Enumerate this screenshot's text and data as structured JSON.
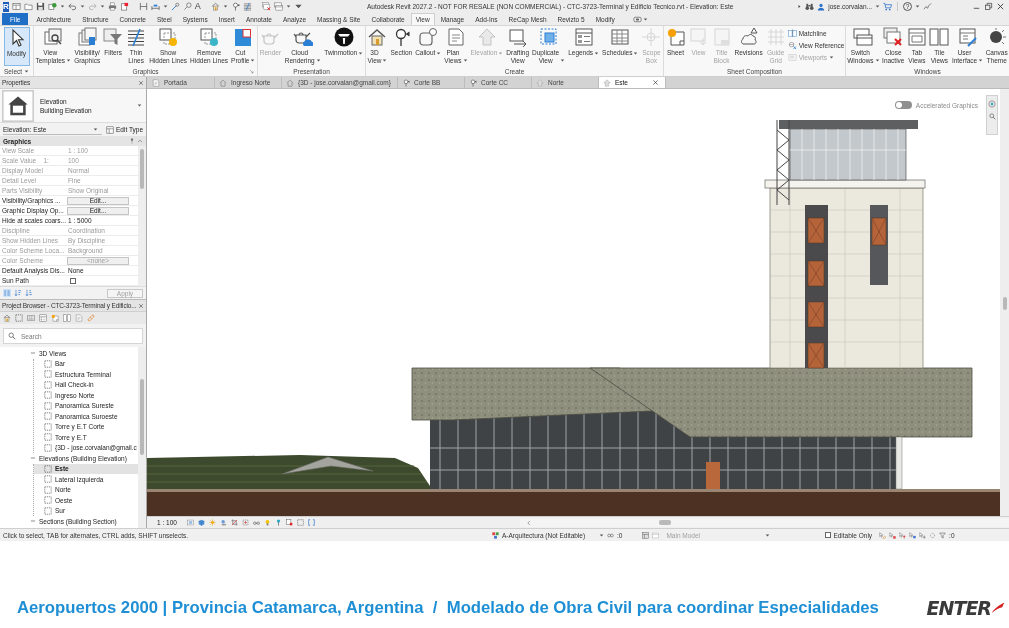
{
  "title_bar": {
    "app_logo": "R",
    "text_glyph": "A",
    "title": "Autodesk Revit 2027.2 - NOT FOR RESALE (NON COMMERCIAL) - CTC-3723-Terminal y Edificio Tecnico.rvt - Elevation: Este",
    "user": "jose.corvalan...",
    "help": "?"
  },
  "ribbon_tabs": [
    {
      "label": "File",
      "kind": "file",
      "selected": false
    },
    {
      "label": "Architecture",
      "kind": "tab",
      "selected": false
    },
    {
      "label": "Structure",
      "kind": "tab",
      "selected": false
    },
    {
      "label": "Concrete",
      "kind": "tab",
      "selected": false
    },
    {
      "label": "Steel",
      "kind": "tab",
      "selected": false
    },
    {
      "label": "Systems",
      "kind": "tab",
      "selected": false
    },
    {
      "label": "Insert",
      "kind": "tab",
      "selected": false
    },
    {
      "label": "Annotate",
      "kind": "tab",
      "selected": false
    },
    {
      "label": "Analyze",
      "kind": "tab",
      "selected": false
    },
    {
      "label": "Massing & Site",
      "kind": "tab",
      "selected": false
    },
    {
      "label": "Collaborate",
      "kind": "tab",
      "selected": false
    },
    {
      "label": "View",
      "kind": "tab",
      "selected": true
    },
    {
      "label": "Manage",
      "kind": "tab",
      "selected": false
    },
    {
      "label": "Add-Ins",
      "kind": "tab",
      "selected": false
    },
    {
      "label": "ReCap Mesh",
      "kind": "tab",
      "selected": false
    },
    {
      "label": "Revizto 5",
      "kind": "tab",
      "selected": false
    },
    {
      "label": "Modify",
      "kind": "tab",
      "selected": false
    }
  ],
  "ribbon_panels": [
    {
      "label": "Select",
      "menu": true,
      "launcher": false,
      "buttons": [
        {
          "label": "Modify",
          "selected": true,
          "disabled": false,
          "dropdown": false
        }
      ]
    },
    {
      "label": "Graphics",
      "menu": false,
      "launcher": true,
      "buttons": [
        {
          "label": "View\nTemplates",
          "selected": false,
          "disabled": false,
          "dropdown": true
        },
        {
          "label": "Visibility/\nGraphics",
          "selected": false,
          "disabled": false,
          "dropdown": false
        },
        {
          "label": "Filters",
          "selected": false,
          "disabled": false,
          "dropdown": false
        },
        {
          "label": "Thin\nLines",
          "selected": false,
          "disabled": false,
          "dropdown": false
        },
        {
          "label": "Show\nHidden Lines",
          "selected": false,
          "disabled": false,
          "dropdown": false
        },
        {
          "label": "Remove\nHidden Lines",
          "selected": false,
          "disabled": false,
          "dropdown": false
        },
        {
          "label": "Cut\nProfile",
          "selected": false,
          "disabled": false,
          "dropdown": true
        }
      ]
    },
    {
      "label": "Presentation",
      "menu": false,
      "launcher": false,
      "buttons": [
        {
          "label": "Render",
          "selected": false,
          "disabled": true,
          "dropdown": false
        },
        {
          "label": "Cloud\nRendering",
          "selected": false,
          "disabled": false,
          "dropdown": true
        },
        {
          "label": "Twinmotion",
          "selected": false,
          "disabled": false,
          "dropdown": true
        }
      ]
    },
    {
      "label": "Create",
      "menu": false,
      "launcher": false,
      "buttons": [
        {
          "label": "3D\nView",
          "selected": false,
          "disabled": false,
          "dropdown": true
        },
        {
          "label": "Section",
          "selected": false,
          "disabled": false,
          "dropdown": false
        },
        {
          "label": "Callout",
          "selected": false,
          "disabled": false,
          "dropdown": true
        },
        {
          "label": "Plan\nViews",
          "selected": false,
          "disabled": false,
          "dropdown": true
        },
        {
          "label": "Elevation",
          "selected": false,
          "disabled": true,
          "dropdown": true
        },
        {
          "label": "Drafting\nView",
          "selected": false,
          "disabled": false,
          "dropdown": false
        },
        {
          "label": "Duplicate\nView",
          "selected": false,
          "disabled": false,
          "dropdown": true
        },
        {
          "label": "Legends",
          "selected": false,
          "disabled": false,
          "dropdown": true
        },
        {
          "label": "Schedules",
          "selected": false,
          "disabled": false,
          "dropdown": true
        },
        {
          "label": "Scope\nBox",
          "selected": false,
          "disabled": true,
          "dropdown": false
        }
      ]
    },
    {
      "label": "Sheet Composition",
      "menu": false,
      "launcher": false,
      "buttons": [
        {
          "label": "Sheet",
          "selected": false,
          "disabled": false,
          "dropdown": false
        },
        {
          "label": "View",
          "selected": false,
          "disabled": true,
          "dropdown": false
        },
        {
          "label": "Title\nBlock",
          "selected": false,
          "disabled": true,
          "dropdown": false
        },
        {
          "label": "Revisions",
          "selected": false,
          "disabled": false,
          "dropdown": false
        },
        {
          "label": "Guide\nGrid",
          "selected": false,
          "disabled": true,
          "dropdown": false
        }
      ],
      "small_buttons": [
        {
          "label": "Matchline",
          "disabled": false,
          "dropdown": false
        },
        {
          "label": "View Reference",
          "disabled": false,
          "dropdown": false
        },
        {
          "label": "Viewports",
          "disabled": true,
          "dropdown": true
        }
      ]
    },
    {
      "label": "Windows",
      "menu": false,
      "launcher": false,
      "buttons": [
        {
          "label": "Switch\nWindows",
          "selected": false,
          "disabled": false,
          "dropdown": true
        },
        {
          "label": "Close\nInactive",
          "selected": false,
          "disabled": false,
          "dropdown": false
        },
        {
          "label": "Tab\nViews",
          "selected": false,
          "disabled": false,
          "dropdown": false
        },
        {
          "label": "Tile\nViews",
          "selected": false,
          "disabled": false,
          "dropdown": false
        },
        {
          "label": "User\nInterface",
          "selected": false,
          "disabled": false,
          "dropdown": true
        },
        {
          "label": "Canvas\nTheme",
          "selected": false,
          "disabled": false,
          "dropdown": false
        }
      ]
    }
  ],
  "properties": {
    "title": "Properties",
    "type_name": "Elevation",
    "type_family": "Building Elevation",
    "instance": "Elevation: Este",
    "edit_type": "Edit Type",
    "group": "Graphics",
    "rows": [
      {
        "label": "View Scale",
        "value": "1 : 100",
        "kind": "text",
        "disabled": true
      },
      {
        "label": "Scale Value    1:",
        "value": "100",
        "kind": "text",
        "disabled": true
      },
      {
        "label": "Display Model",
        "value": "Normal",
        "kind": "text",
        "disabled": true
      },
      {
        "label": "Detail Level",
        "value": "Fine",
        "kind": "text",
        "disabled": true
      },
      {
        "label": "Parts Visibility",
        "value": "Show Original",
        "kind": "text",
        "disabled": true
      },
      {
        "label": "Visibility/Graphics ...",
        "value": "Edit...",
        "kind": "button",
        "disabled": false
      },
      {
        "label": "Graphic Display Op...",
        "value": "Edit...",
        "kind": "button",
        "disabled": false
      },
      {
        "label": "Hide at scales coars...",
        "value": "1 : 5000",
        "kind": "text",
        "disabled": false
      },
      {
        "label": "Discipline",
        "value": "Coordination",
        "kind": "text",
        "disabled": true
      },
      {
        "label": "Show Hidden Lines",
        "value": "By Discipline",
        "kind": "text",
        "disabled": true
      },
      {
        "label": "Color Scheme Loca...",
        "value": "Background",
        "kind": "text",
        "disabled": true
      },
      {
        "label": "Color Scheme",
        "value": "<none>",
        "kind": "button",
        "disabled": true
      },
      {
        "label": "Default Analysis Dis...",
        "value": "None",
        "kind": "text",
        "disabled": false
      },
      {
        "label": "Sun Path",
        "kind": "checkbox",
        "checked": false,
        "disabled": false
      }
    ],
    "apply": "Apply",
    "apply_disabled": true
  },
  "project_browser": {
    "title": "Project Browser - CTC-3723-Terminal y Edificio...",
    "search_placeholder": "Search",
    "tree": [
      {
        "label": "3D Views",
        "expanded": true,
        "selected": false,
        "children": [
          {
            "label": "Bar",
            "selected": false
          },
          {
            "label": "Estructura Terminal",
            "selected": false
          },
          {
            "label": "Hall Check-in",
            "selected": false
          },
          {
            "label": "Ingreso Norte",
            "selected": false
          },
          {
            "label": "Panoramica Sureste",
            "selected": false
          },
          {
            "label": "Panoramica Suroeste",
            "selected": false
          },
          {
            "label": "Torre y E.T Corte",
            "selected": false
          },
          {
            "label": "Torre y E.T",
            "selected": false
          },
          {
            "label": "{3D - jose.corvalan@gmail.c",
            "selected": false
          }
        ]
      },
      {
        "label": "Elevations (Building Elevation)",
        "expanded": true,
        "selected": false,
        "children": [
          {
            "label": "Este",
            "selected": true
          },
          {
            "label": "Lateral Izquierda",
            "selected": false
          },
          {
            "label": "Norte",
            "selected": false
          },
          {
            "label": "Oeste",
            "selected": false
          },
          {
            "label": "Sur",
            "selected": false
          }
        ]
      },
      {
        "label": "Sections (Building Section)",
        "expanded": true,
        "selected": false
      }
    ]
  },
  "view_tabs": [
    {
      "label": "Portada",
      "kind": "sheet",
      "selected": false
    },
    {
      "label": "Ingreso Norte",
      "kind": "isometric",
      "selected": false
    },
    {
      "label": "{3D - jose.corvalan@gmail.com}",
      "kind": "isometric",
      "selected": false
    },
    {
      "label": "Corte BB",
      "kind": "section",
      "selected": false
    },
    {
      "label": "Corte CC",
      "kind": "section",
      "selected": false
    },
    {
      "label": "Norte",
      "kind": "elevation",
      "selected": false
    },
    {
      "label": "Este",
      "kind": "elevation",
      "selected": true
    }
  ],
  "canvas": {
    "accelerated_graphics": {
      "label": "Accelerated Graphics",
      "on": false
    }
  },
  "view_control_bar": {
    "scale": "1 : 100"
  },
  "status_bar": {
    "hint": "Click to select, TAB for alternates, CTRL adds, SHIFT unselects.",
    "workset": "A-Arquitectura (Not Editable)",
    "editing_requests": ":0",
    "design_option": "Main Model",
    "design_option_disabled": true,
    "editable_only": {
      "label": "Editable Only",
      "checked": false
    },
    "filter_count": ":0"
  },
  "caption": {
    "text": "Aeropuertos 2000 | Provincia Catamarca, Argentina  /  Modelado de Obra Civil para coordinar Especialidades",
    "logo": "ENTER"
  }
}
